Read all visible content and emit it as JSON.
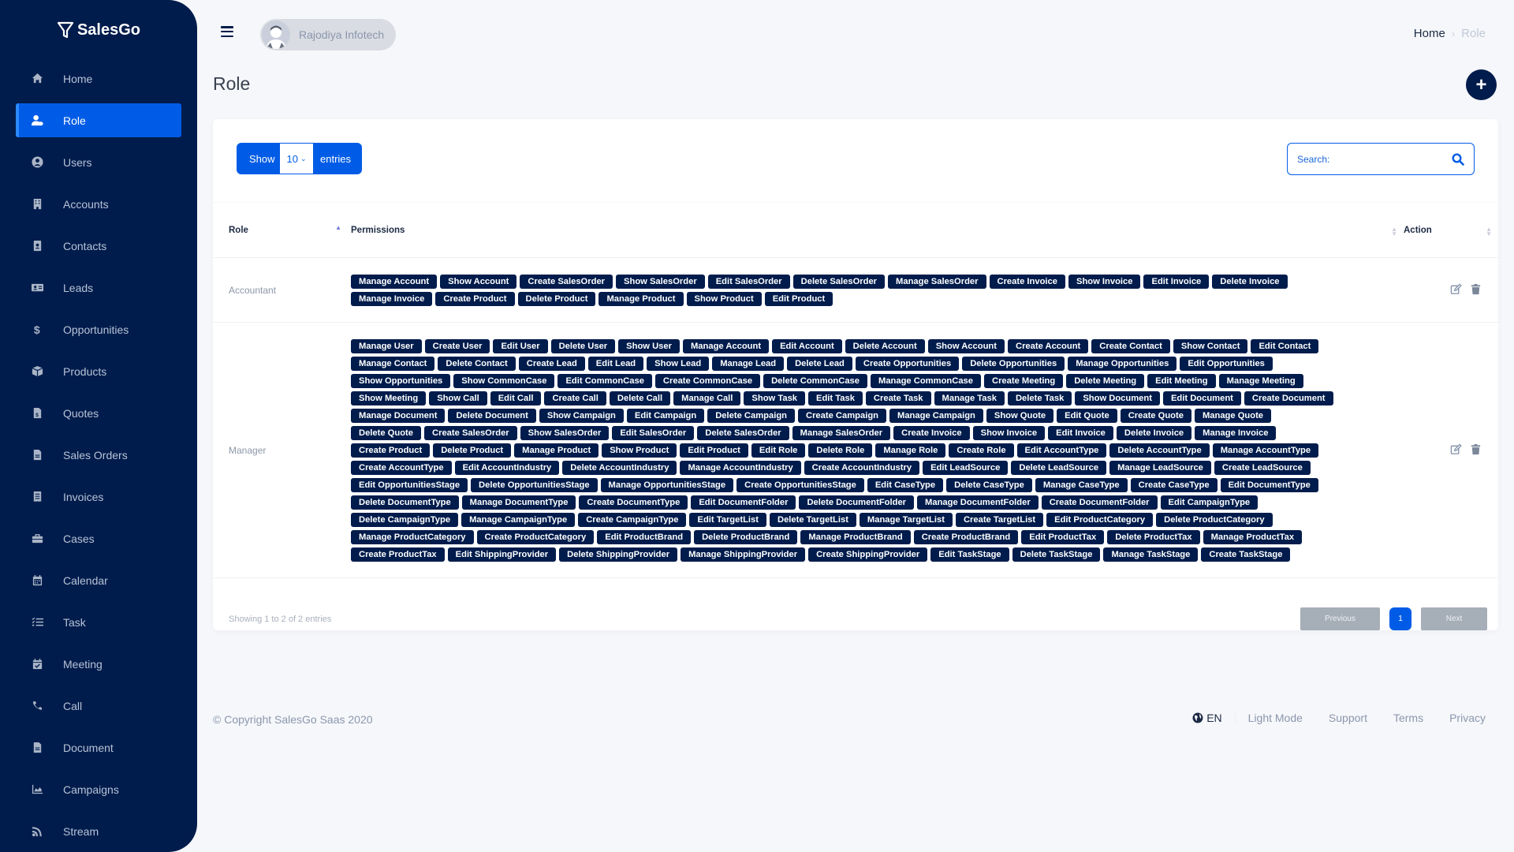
{
  "app": {
    "brand": "SalesGo"
  },
  "sidebar": {
    "items": [
      {
        "label": "Home",
        "icon": "home-icon",
        "active": false
      },
      {
        "label": "Role",
        "icon": "user-tag-icon",
        "active": true
      },
      {
        "label": "Users",
        "icon": "user-circle-icon",
        "active": false
      },
      {
        "label": "Accounts",
        "icon": "building-icon",
        "active": false
      },
      {
        "label": "Contacts",
        "icon": "id-badge-icon",
        "active": false
      },
      {
        "label": "Leads",
        "icon": "address-card-icon",
        "active": false
      },
      {
        "label": "Opportunities",
        "icon": "dollar-icon",
        "active": false
      },
      {
        "label": "Products",
        "icon": "box-icon",
        "active": false
      },
      {
        "label": "Quotes",
        "icon": "file-invoice-dollar-icon",
        "active": false
      },
      {
        "label": "Sales Orders",
        "icon": "file-alt-icon",
        "active": false
      },
      {
        "label": "Invoices",
        "icon": "receipt-icon",
        "active": false
      },
      {
        "label": "Cases",
        "icon": "briefcase-icon",
        "active": false
      },
      {
        "label": "Calendar",
        "icon": "calendar-icon",
        "active": false
      },
      {
        "label": "Task",
        "icon": "tasks-icon",
        "active": false
      },
      {
        "label": "Meeting",
        "icon": "calendar-check-icon",
        "active": false
      },
      {
        "label": "Call",
        "icon": "phone-icon",
        "active": false
      },
      {
        "label": "Document",
        "icon": "file-icon",
        "active": false
      },
      {
        "label": "Campaigns",
        "icon": "chart-area-icon",
        "active": false
      },
      {
        "label": "Stream",
        "icon": "rss-icon",
        "active": false
      }
    ]
  },
  "header": {
    "user_name": "Rajodiya Infotech",
    "breadcrumb": {
      "home": "Home",
      "separator": "›",
      "current": "Role"
    }
  },
  "page": {
    "title": "Role",
    "add_button": "+"
  },
  "table_controls": {
    "show_label": "Show",
    "entries_value": "10",
    "entries_label": "entries",
    "search_placeholder": "Search:"
  },
  "table": {
    "columns": [
      "Role",
      "Permissions",
      "Action"
    ],
    "rows": [
      {
        "role": "Accountant",
        "permissions": [
          "Manage Account",
          "Show Account",
          "Create SalesOrder",
          "Show SalesOrder",
          "Edit SalesOrder",
          "Delete SalesOrder",
          "Manage SalesOrder",
          "Create Invoice",
          "Show Invoice",
          "Edit Invoice",
          "Delete Invoice",
          "Manage Invoice",
          "Create Product",
          "Delete Product",
          "Manage Product",
          "Show Product",
          "Edit Product"
        ]
      },
      {
        "role": "Manager",
        "permissions": [
          "Manage User",
          "Create User",
          "Edit User",
          "Delete User",
          "Show User",
          "Manage Account",
          "Edit Account",
          "Delete Account",
          "Show Account",
          "Create Account",
          "Create Contact",
          "Show Contact",
          "Edit Contact",
          "Manage Contact",
          "Delete Contact",
          "Create Lead",
          "Edit Lead",
          "Show Lead",
          "Manage Lead",
          "Delete Lead",
          "Create Opportunities",
          "Delete Opportunities",
          "Manage Opportunities",
          "Edit Opportunities",
          "Show Opportunities",
          "Show CommonCase",
          "Edit CommonCase",
          "Create CommonCase",
          "Delete CommonCase",
          "Manage CommonCase",
          "Create Meeting",
          "Delete Meeting",
          "Edit Meeting",
          "Manage Meeting",
          "Show Meeting",
          "Show Call",
          "Edit Call",
          "Create Call",
          "Delete Call",
          "Manage Call",
          "Show Task",
          "Edit Task",
          "Create Task",
          "Manage Task",
          "Delete Task",
          "Show Document",
          "Edit Document",
          "Create Document",
          "Manage Document",
          "Delete Document",
          "Show Campaign",
          "Edit Campaign",
          "Delete Campaign",
          "Create Campaign",
          "Manage Campaign",
          "Show Quote",
          "Edit Quote",
          "Create Quote",
          "Manage Quote",
          "Delete Quote",
          "Create SalesOrder",
          "Show SalesOrder",
          "Edit SalesOrder",
          "Delete SalesOrder",
          "Manage SalesOrder",
          "Create Invoice",
          "Show Invoice",
          "Edit Invoice",
          "Delete Invoice",
          "Manage Invoice",
          "Create Product",
          "Delete Product",
          "Manage Product",
          "Show Product",
          "Edit Product",
          "Edit Role",
          "Delete Role",
          "Manage Role",
          "Create Role",
          "Edit AccountType",
          "Delete AccountType",
          "Manage AccountType",
          "Create AccountType",
          "Edit AccountIndustry",
          "Delete AccountIndustry",
          "Manage AccountIndustry",
          "Create AccountIndustry",
          "Edit LeadSource",
          "Delete LeadSource",
          "Manage LeadSource",
          "Create LeadSource",
          "Edit OpportunitiesStage",
          "Delete OpportunitiesStage",
          "Manage OpportunitiesStage",
          "Create OpportunitiesStage",
          "Edit CaseType",
          "Delete CaseType",
          "Manage CaseType",
          "Create CaseType",
          "Edit DocumentType",
          "Delete DocumentType",
          "Manage DocumentType",
          "Create DocumentType",
          "Edit DocumentFolder",
          "Delete DocumentFolder",
          "Manage DocumentFolder",
          "Create DocumentFolder",
          "Edit CampaignType",
          "Delete CampaignType",
          "Manage CampaignType",
          "Create CampaignType",
          "Edit TargetList",
          "Delete TargetList",
          "Manage TargetList",
          "Create TargetList",
          "Edit ProductCategory",
          "Delete ProductCategory",
          "Manage ProductCategory",
          "Create ProductCategory",
          "Edit ProductBrand",
          "Delete ProductBrand",
          "Manage ProductBrand",
          "Create ProductBrand",
          "Edit ProductTax",
          "Delete ProductTax",
          "Manage ProductTax",
          "Create ProductTax",
          "Edit ShippingProvider",
          "Delete ShippingProvider",
          "Manage ShippingProvider",
          "Create ShippingProvider",
          "Edit TaskStage",
          "Delete TaskStage",
          "Manage TaskStage",
          "Create TaskStage"
        ]
      }
    ],
    "info": "Showing 1 to 2 of 2 entries",
    "pagination": {
      "previous": "Previous",
      "page": "1",
      "next": "Next"
    }
  },
  "footer": {
    "copyright": "© Copyright SalesGo Saas 2020",
    "language": "EN",
    "links": [
      "Light Mode",
      "Support",
      "Terms",
      "Privacy"
    ]
  },
  "colors": {
    "sidebar": "#001c4c",
    "accent": "#005ce6",
    "badge": "#001c4c"
  }
}
